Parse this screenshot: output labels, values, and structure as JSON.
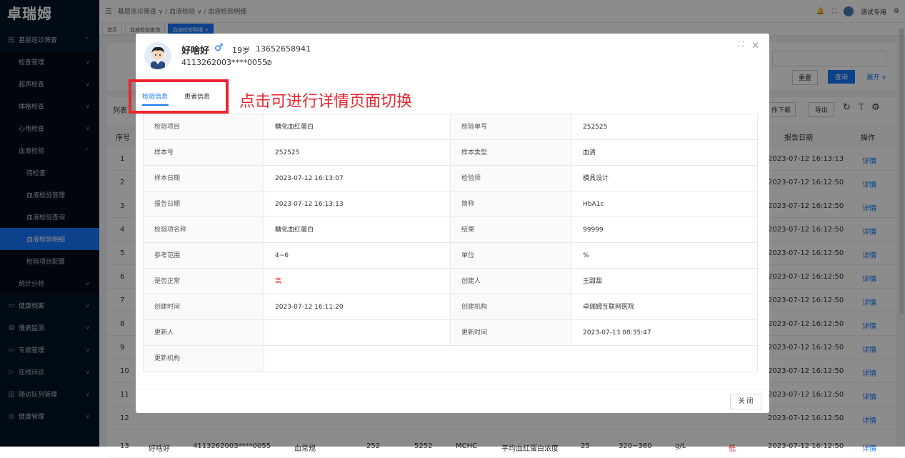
{
  "app": {
    "logo": "卓瑞姆"
  },
  "sidebar": {
    "items": [
      {
        "icon": "田",
        "label": "基层巡诊筛查",
        "chev": "^",
        "type": "top"
      },
      {
        "label": "检查管理",
        "chev": "v",
        "type": "sub"
      },
      {
        "label": "超声检查",
        "chev": "v",
        "type": "sub"
      },
      {
        "label": "体格检查",
        "chev": "v",
        "type": "sub"
      },
      {
        "label": "心电检查",
        "chev": "v",
        "type": "sub"
      },
      {
        "label": "血液检验",
        "chev": "^",
        "type": "sub"
      },
      {
        "label": "待检查",
        "chev": "",
        "type": "sub2"
      },
      {
        "label": "血液检验管理",
        "chev": "",
        "type": "sub2"
      },
      {
        "label": "血液检验查询",
        "chev": "",
        "type": "sub2"
      },
      {
        "label": "血液检验明细",
        "chev": "",
        "type": "active"
      },
      {
        "label": "检验项目配置",
        "chev": "",
        "type": "sub2"
      },
      {
        "label": "统计分析",
        "chev": "v",
        "type": "sub"
      },
      {
        "icon": "▭",
        "label": "健康档案",
        "chev": "v",
        "type": "top"
      },
      {
        "icon": "▤",
        "label": "慢病监测",
        "chev": "v",
        "type": "top"
      },
      {
        "icon": "▭",
        "label": "专病管理",
        "chev": "v",
        "type": "top"
      },
      {
        "icon": "▷",
        "label": "在线问诊",
        "chev": "v",
        "type": "top"
      },
      {
        "icon": "田",
        "label": "随访队列管理",
        "chev": "v",
        "type": "top"
      },
      {
        "icon": "◎",
        "label": "健康管理",
        "chev": "v",
        "type": "top"
      }
    ]
  },
  "header": {
    "breadcrumb": "基层巡诊筛查 ∨ / 血液检验 ∨ / 血液检验明细",
    "user": "测试专用"
  },
  "tabs": [
    "首页",
    "血液检验查询",
    "血液检验明细 ×"
  ],
  "search": {
    "reset": "重置",
    "query": "查询",
    "expand": "展开 ∨"
  },
  "list": {
    "title": "列表",
    "tools": {
      "download": "件下载",
      "export": "导出"
    },
    "headers": {
      "index": "序号",
      "report_date": "报告日期",
      "action": "操作"
    },
    "rows": [
      {
        "i": "1",
        "date": "2023-07-12 16:13:13",
        "a": "详情"
      },
      {
        "i": "2",
        "date": "2023-07-12 16:12:50",
        "a": "详情"
      },
      {
        "i": "3",
        "date": "2023-07-12 16:12:50",
        "a": "详情"
      },
      {
        "i": "4",
        "date": "2023-07-12 16:12:50",
        "a": "详情"
      },
      {
        "i": "5",
        "date": "2023-07-12 16:12:50",
        "a": "详情"
      },
      {
        "i": "6",
        "date": "2023-07-12 16:12:50",
        "a": "详情"
      },
      {
        "i": "7",
        "date": "2023-07-12 16:12:50",
        "a": "详情"
      },
      {
        "i": "8",
        "date": "2023-07-12 16:12:50",
        "a": "详情"
      },
      {
        "i": "9",
        "date": "2023-07-12 16:12:50",
        "a": "详情"
      },
      {
        "i": "10",
        "date": "2023-07-12 16:12:50",
        "a": "详情"
      },
      {
        "i": "11",
        "date": "2023-07-12 16:12:50",
        "a": "详情"
      },
      {
        "i": "12",
        "date": "2023-07-12 16:12:50",
        "a": "详情"
      }
    ],
    "last_row": {
      "i": "13",
      "name": "好啥好",
      "id": "4113262003****0055",
      "type": "血常规",
      "c1": "252",
      "c2": "5252",
      "abbr": "MCHC",
      "item": "平均血红蛋白浓度",
      "result": "25",
      "range": "320~360",
      "unit": "g/L",
      "flag": "低",
      "date": "2023-07-12 16:12:50",
      "a": "详情"
    }
  },
  "modal": {
    "patient": {
      "name": "好啥好",
      "gender": "♂",
      "age": "19岁",
      "phone": "13652658941",
      "id_no": "4113262003****0055"
    },
    "tabs": {
      "exam": "检验信息",
      "patient": "患者信息"
    },
    "annotation": "点击可进行详情页面切换",
    "rows": [
      {
        "l1": "检验项目",
        "v1": "糖化血红蛋白",
        "l2": "检验单号",
        "v2": "252525"
      },
      {
        "l1": "样本号",
        "v1": "252525",
        "l2": "样本类型",
        "v2": "血清"
      },
      {
        "l1": "样本日期",
        "v1": "2023-07-12 16:13:07",
        "l2": "检验师",
        "v2": "模具设计"
      },
      {
        "l1": "报告日期",
        "v1": "2023-07-12 16:13:13",
        "l2": "简称",
        "v2": "HbA1c"
      },
      {
        "l1": "检验项名称",
        "v1": "糖化血红蛋白",
        "l2": "结果",
        "v2": "99999"
      },
      {
        "l1": "参考范围",
        "v1": "4~6",
        "l2": "单位",
        "v2": "%"
      },
      {
        "l1": "是否正常",
        "v1": "高",
        "l2": "创建人",
        "v2": "王甜甜"
      },
      {
        "l1": "创建时间",
        "v1": "2023-07-12 16:11:20",
        "l2": "创建机构",
        "v2": "卓瑞姆互联网医院"
      },
      {
        "l1": "更新人",
        "v1": "",
        "l2": "更新时间",
        "v2": "2023-07-13 08:35:47"
      }
    ],
    "last_label": "更新机构",
    "close": "关 闭"
  },
  "colors": {
    "primary": "#1677ff",
    "danger": "#e8262f",
    "sidebar_bg": "#001529"
  }
}
